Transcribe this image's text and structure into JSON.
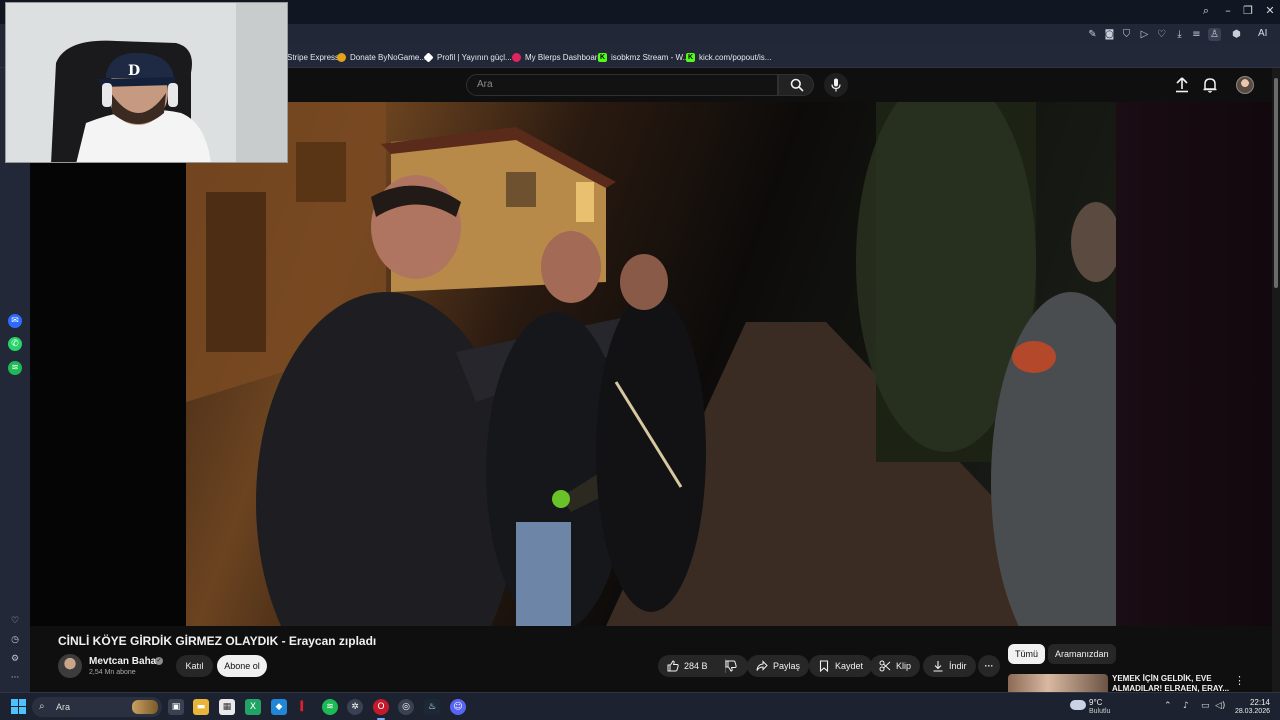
{
  "window": {
    "minimize": "–",
    "restore": "❐",
    "close": "✕"
  },
  "toolbar": {
    "ai_label": "AI"
  },
  "bookmarks": [
    {
      "label": "Stripe Express",
      "color": "#5b5fc7",
      "glyph": ""
    },
    {
      "label": "Donate ByNoGame...",
      "color": "#e3a21a",
      "glyph": ""
    },
    {
      "label": "Profil | Yayının güçl...",
      "color": "#ffffff",
      "glyph": ""
    },
    {
      "label": "My Blerps Dashboard",
      "color": "#e0245e",
      "glyph": ""
    },
    {
      "label": "isobkmz Stream - W...",
      "color": "#53fc18",
      "glyph": "K"
    },
    {
      "label": "kick.com/popout/is...",
      "color": "#53fc18",
      "glyph": "K"
    }
  ],
  "youtube": {
    "search_placeholder": "Ara"
  },
  "video": {
    "title": "CİNLİ KÖYE GİRDİK GİRMEZ OLAYDIK - Eraycan zıpladı",
    "channel_name": "Mevtcan Bahav",
    "subscribers": "2,54 Mn abone",
    "join_label": "Katıl",
    "subscribe_label": "Abone ol",
    "likes": "284 B",
    "share_label": "Paylaş",
    "save_label": "Kaydet",
    "clip_label": "Klip",
    "download_label": "İndir",
    "more_label": "···"
  },
  "recommendations": {
    "chip_all": "Tümü",
    "chip_search": "Aramanızdan",
    "first_title": "YEMEK İÇİN GELDİK, EVE ALMADILAR! ELRAEN, ERAY..."
  },
  "taskbar": {
    "search_label": "Ara",
    "weather_temp": "9°C",
    "weather_desc": "Bulutlu",
    "time": "22:14",
    "date": "28.03.2026"
  },
  "colors": {
    "youtube_bg": "#0f0f0f",
    "browser_toolbar": "#222738",
    "taskbar": "#1d2230",
    "subscribe_bg": "#f1f1f1"
  }
}
